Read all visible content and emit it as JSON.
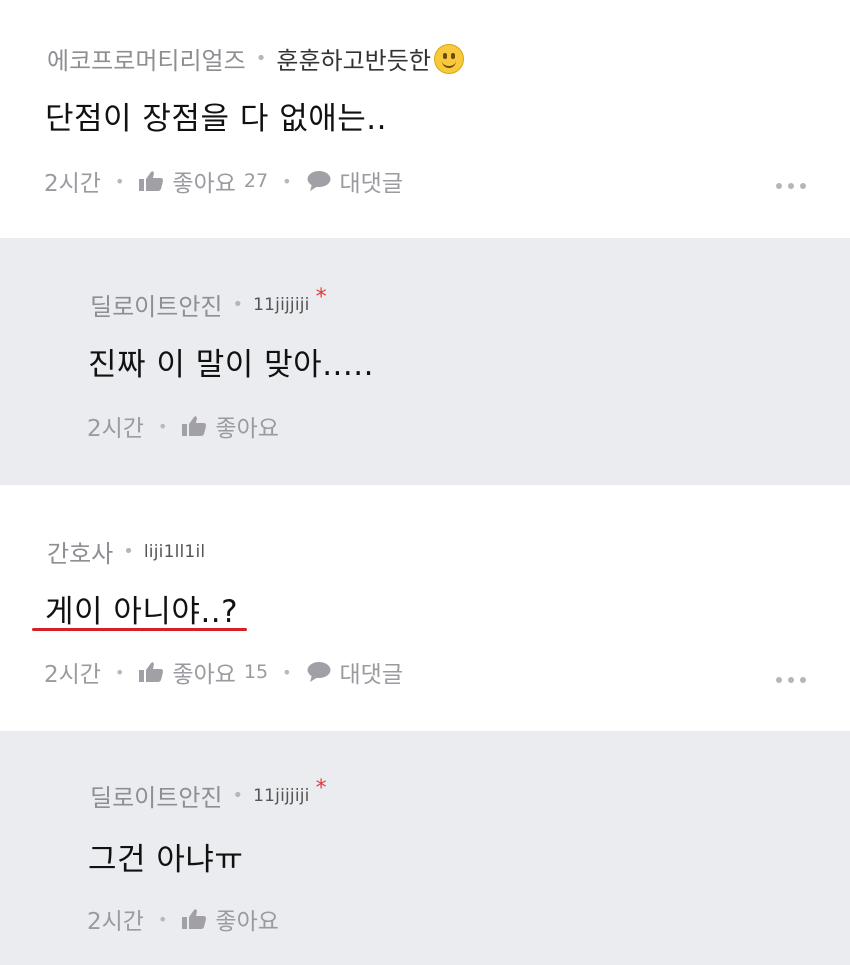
{
  "comments": [
    {
      "author": "에코프로머티리얼즈",
      "subtitle": "훈훈하고반듯한",
      "subtitle_icon": "smile-emoji-icon",
      "text": "단점이 장점을 다 없애는..",
      "time": "2시간",
      "like_label": "좋아요",
      "like_count": "27",
      "reply_label": "대댓글"
    },
    {
      "author": "딜로이트안진",
      "subtitle": "11jijjiji",
      "badge": "*",
      "text": "진짜 이 말이 맞아.....",
      "time": "2시간",
      "like_label": "좋아요"
    },
    {
      "author": "간호사",
      "subtitle": "liji1ll1il",
      "text": "게이 아니야..?",
      "time": "2시간",
      "like_label": "좋아요",
      "like_count": "15",
      "reply_label": "대댓글"
    },
    {
      "author": "딜로이트안진",
      "subtitle": "11jijjiji",
      "badge": "*",
      "text": "그건 아냐ㅠ",
      "time": "2시간",
      "like_label": "좋아요"
    }
  ],
  "colors": {
    "reply_background": "#ebecf0",
    "highlight_underline": "#d81f26",
    "badge": "#e23a3a",
    "emoji": "#f8c93a"
  },
  "icons": [
    "thumbs-up-icon",
    "speech-bubble-icon",
    "more-options-icon",
    "smile-emoji-icon"
  ]
}
